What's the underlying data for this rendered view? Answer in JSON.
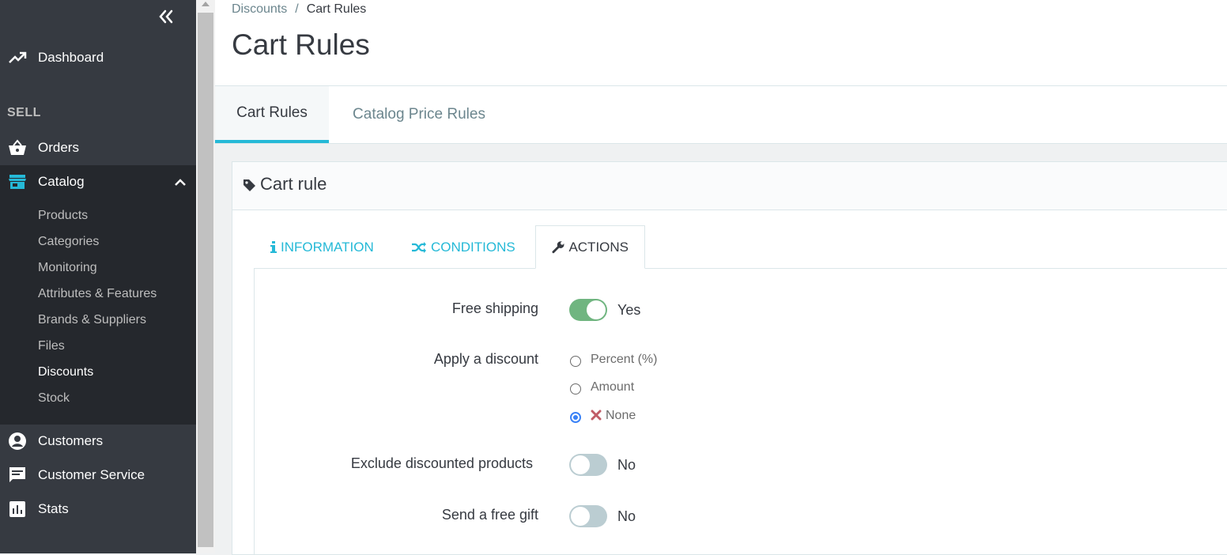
{
  "sidebar": {
    "dashboard": "Dashboard",
    "sell_section": "SELL",
    "orders": "Orders",
    "catalog": "Catalog",
    "catalog_items": [
      "Products",
      "Categories",
      "Monitoring",
      "Attributes & Features",
      "Brands & Suppliers",
      "Files",
      "Discounts",
      "Stock"
    ],
    "customers": "Customers",
    "customer_service": "Customer Service",
    "stats": "Stats"
  },
  "breadcrumb": {
    "parent": "Discounts",
    "separator": "/",
    "current": "Cart Rules"
  },
  "page_title": "Cart Rules",
  "top_tabs": [
    "Cart Rules",
    "Catalog Price Rules"
  ],
  "panel": {
    "title": "Cart rule",
    "tabs": [
      "INFORMATION",
      "CONDITIONS",
      "ACTIONS"
    ],
    "active_tab": "ACTIONS"
  },
  "form": {
    "free_shipping": {
      "label": "Free shipping",
      "state": "Yes"
    },
    "apply_discount": {
      "label": "Apply a discount",
      "options": [
        "Percent (%)",
        "Amount",
        "None"
      ],
      "selected": "None"
    },
    "exclude_discounted": {
      "label": "Exclude discounted products",
      "state": "No"
    },
    "free_gift": {
      "label": "Send a free gift",
      "state": "No"
    }
  },
  "colors": {
    "accent": "#25b9d7",
    "switch_on": "#70b580",
    "switch_off": "#bbcdd2",
    "sidebar_bg": "#363a41",
    "none_icon": "#c05c67"
  }
}
